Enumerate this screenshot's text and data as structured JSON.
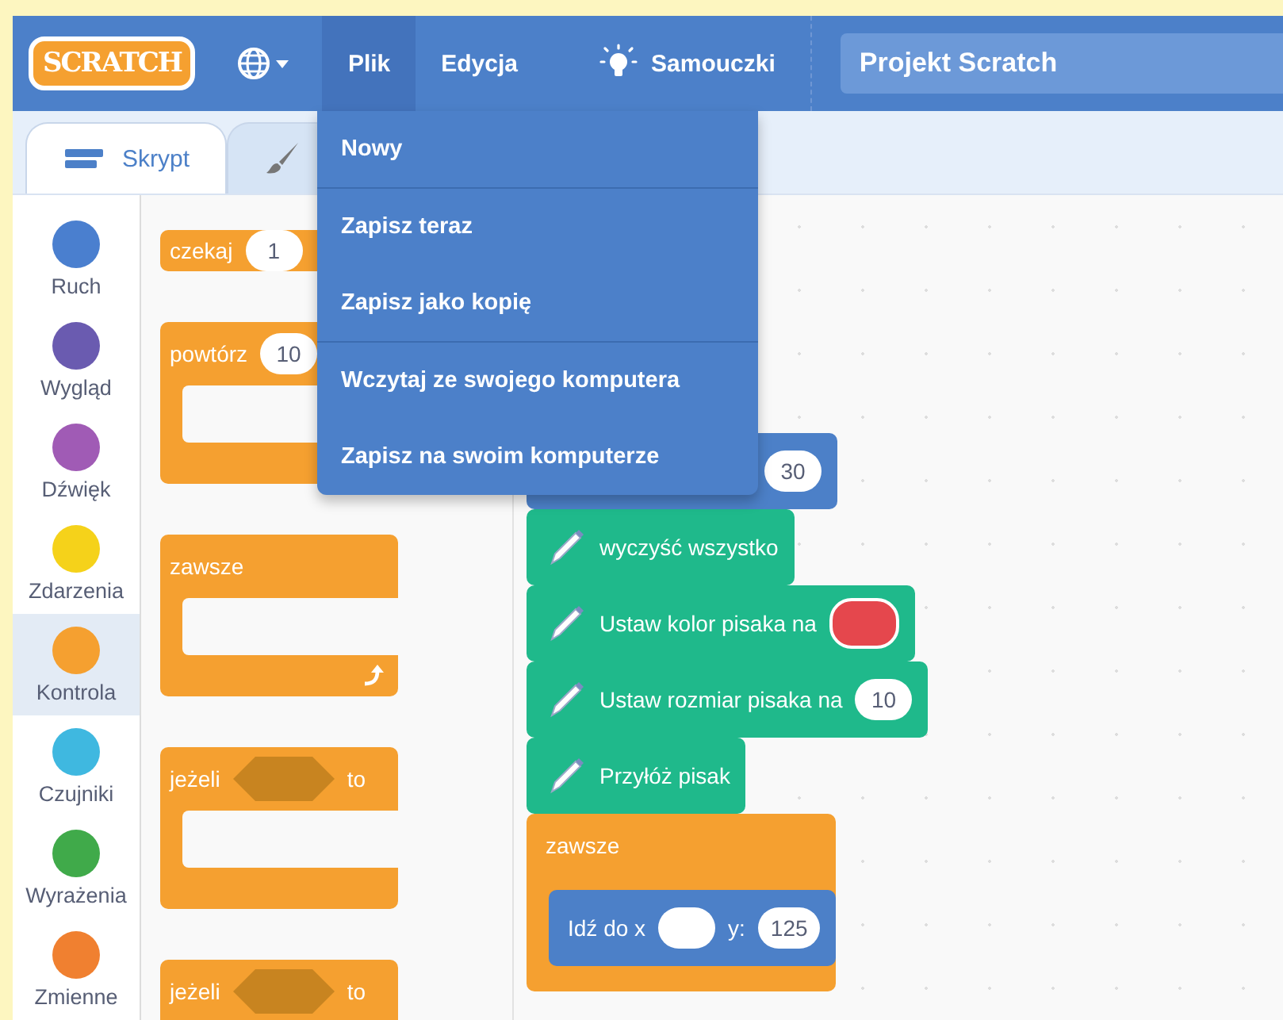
{
  "menu_bar": {
    "logo": "SCRATCH",
    "menus": [
      {
        "label": "Plik",
        "selected": true
      },
      {
        "label": "Edycja",
        "selected": false
      }
    ],
    "tutorials": "Samouczki",
    "project_title": "Projekt Scratch"
  },
  "file_menu": [
    {
      "label": "Nowy",
      "group_start": false
    },
    {
      "label": "Zapisz teraz",
      "group_start": true
    },
    {
      "label": "Zapisz jako kopię",
      "group_start": false
    },
    {
      "label": "Wczytaj ze swojego komputera",
      "group_start": true
    },
    {
      "label": "Zapisz na swoim komputerze",
      "group_start": false
    }
  ],
  "tabs": [
    {
      "label": "Skrypt",
      "selected": true
    },
    {
      "selected": false
    }
  ],
  "categories": [
    {
      "label": "Ruch",
      "color": "#4a7fcf",
      "selected": false
    },
    {
      "label": "Wygląd",
      "color": "#6a5bb0",
      "selected": false
    },
    {
      "label": "Dźwięk",
      "color": "#a05bb5",
      "selected": false
    },
    {
      "label": "Zdarzenia",
      "color": "#f5d21a",
      "selected": false
    },
    {
      "label": "Kontrola",
      "color": "#f5a030",
      "selected": true
    },
    {
      "label": "Czujniki",
      "color": "#3fb8e0",
      "selected": false
    },
    {
      "label": "Wyrażenia",
      "color": "#40aa4a",
      "selected": false
    },
    {
      "label": "Zmienne",
      "color": "#f08030",
      "selected": false
    }
  ],
  "palette": [
    {
      "kind": "stack",
      "label": "czekaj",
      "input": "1"
    },
    {
      "kind": "loop",
      "label": "powtórz",
      "input": "10"
    },
    {
      "kind": "forever",
      "label": "zawsze"
    },
    {
      "kind": "if",
      "label": "jeżeli",
      "suffix": "to"
    },
    {
      "kind": "if",
      "label": "jeżeli",
      "suffix": "to"
    }
  ],
  "script": [
    {
      "kind": "motion",
      "parts": [
        {
          "kind": "input",
          "text": "30"
        }
      ]
    },
    {
      "kind": "pen",
      "parts": [
        {
          "kind": "text",
          "text": "wyczyść wszystko"
        }
      ]
    },
    {
      "kind": "pen",
      "parts": [
        {
          "kind": "text",
          "text": "Ustaw kolor pisaka na"
        },
        {
          "kind": "swatch",
          "color": "#e5474d"
        }
      ]
    },
    {
      "kind": "pen",
      "parts": [
        {
          "kind": "text",
          "text": "Ustaw rozmiar pisaka na"
        },
        {
          "kind": "input",
          "text": "10"
        }
      ]
    },
    {
      "kind": "pen",
      "parts": [
        {
          "kind": "text",
          "text": "Przyłóż pisak"
        }
      ]
    },
    {
      "kind": "forever",
      "label": "zawsze",
      "children": [
        {
          "kind": "motion",
          "parts": [
            {
              "kind": "text",
              "text": "Idź do x"
            },
            {
              "kind": "input"
            },
            {
              "kind": "text",
              "text": "y:"
            },
            {
              "kind": "input",
              "text": "125"
            }
          ]
        }
      ]
    }
  ]
}
